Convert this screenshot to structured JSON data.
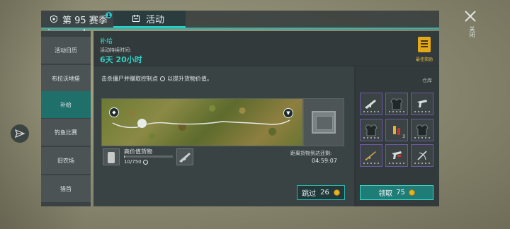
{
  "tabs": {
    "season_label": "第 95 赛季",
    "season_badge": "1",
    "activity_label": "活动"
  },
  "close": {
    "label": "关闭"
  },
  "sidebar": {
    "items": [
      {
        "label": "活动日历",
        "active": false
      },
      {
        "label": "布拉沃地堡",
        "active": false
      },
      {
        "label": "补给",
        "active": true
      },
      {
        "label": "钓鱼比赛",
        "active": false
      },
      {
        "label": "旧农场",
        "active": false
      },
      {
        "label": "猎首",
        "active": false
      }
    ]
  },
  "event": {
    "title": "补给",
    "duration_label": "活动持续时间:",
    "duration_value": "6天 20小时",
    "reward_label": "最佳奖励",
    "instruction_prefix": "击杀僵尸并赚取控制点",
    "instruction_suffix": "以提升货物价值。"
  },
  "cargo": {
    "label": "高价值货物",
    "value_text": "10/750",
    "progress": 0.013,
    "eta_label": "距离货物到达还剩:",
    "eta_value": "04:59:07"
  },
  "warehouse": {
    "label": "仓库",
    "items": [
      {
        "icon": "assault-rifle-icon",
        "count": ""
      },
      {
        "icon": "tactical-vest-icon",
        "count": ""
      },
      {
        "icon": "pistol-icon",
        "count": ""
      },
      {
        "icon": "tactical-vest-icon",
        "count": ""
      },
      {
        "icon": "shotgun-shells-icon",
        "count": "3"
      },
      {
        "icon": "tactical-vest-icon",
        "count": ""
      },
      {
        "icon": "rifle-icon",
        "count": ""
      },
      {
        "icon": "pistol-icon",
        "count": ""
      },
      {
        "icon": "crossbow-icon",
        "count": ""
      }
    ]
  },
  "buttons": {
    "skip_label": "跳过",
    "skip_cost": "26",
    "claim_label": "领取",
    "claim_cost": "75"
  },
  "colors": {
    "accent": "#2ad3c9",
    "gold": "#e3a81b",
    "slot_border": "#6c5aa2"
  }
}
